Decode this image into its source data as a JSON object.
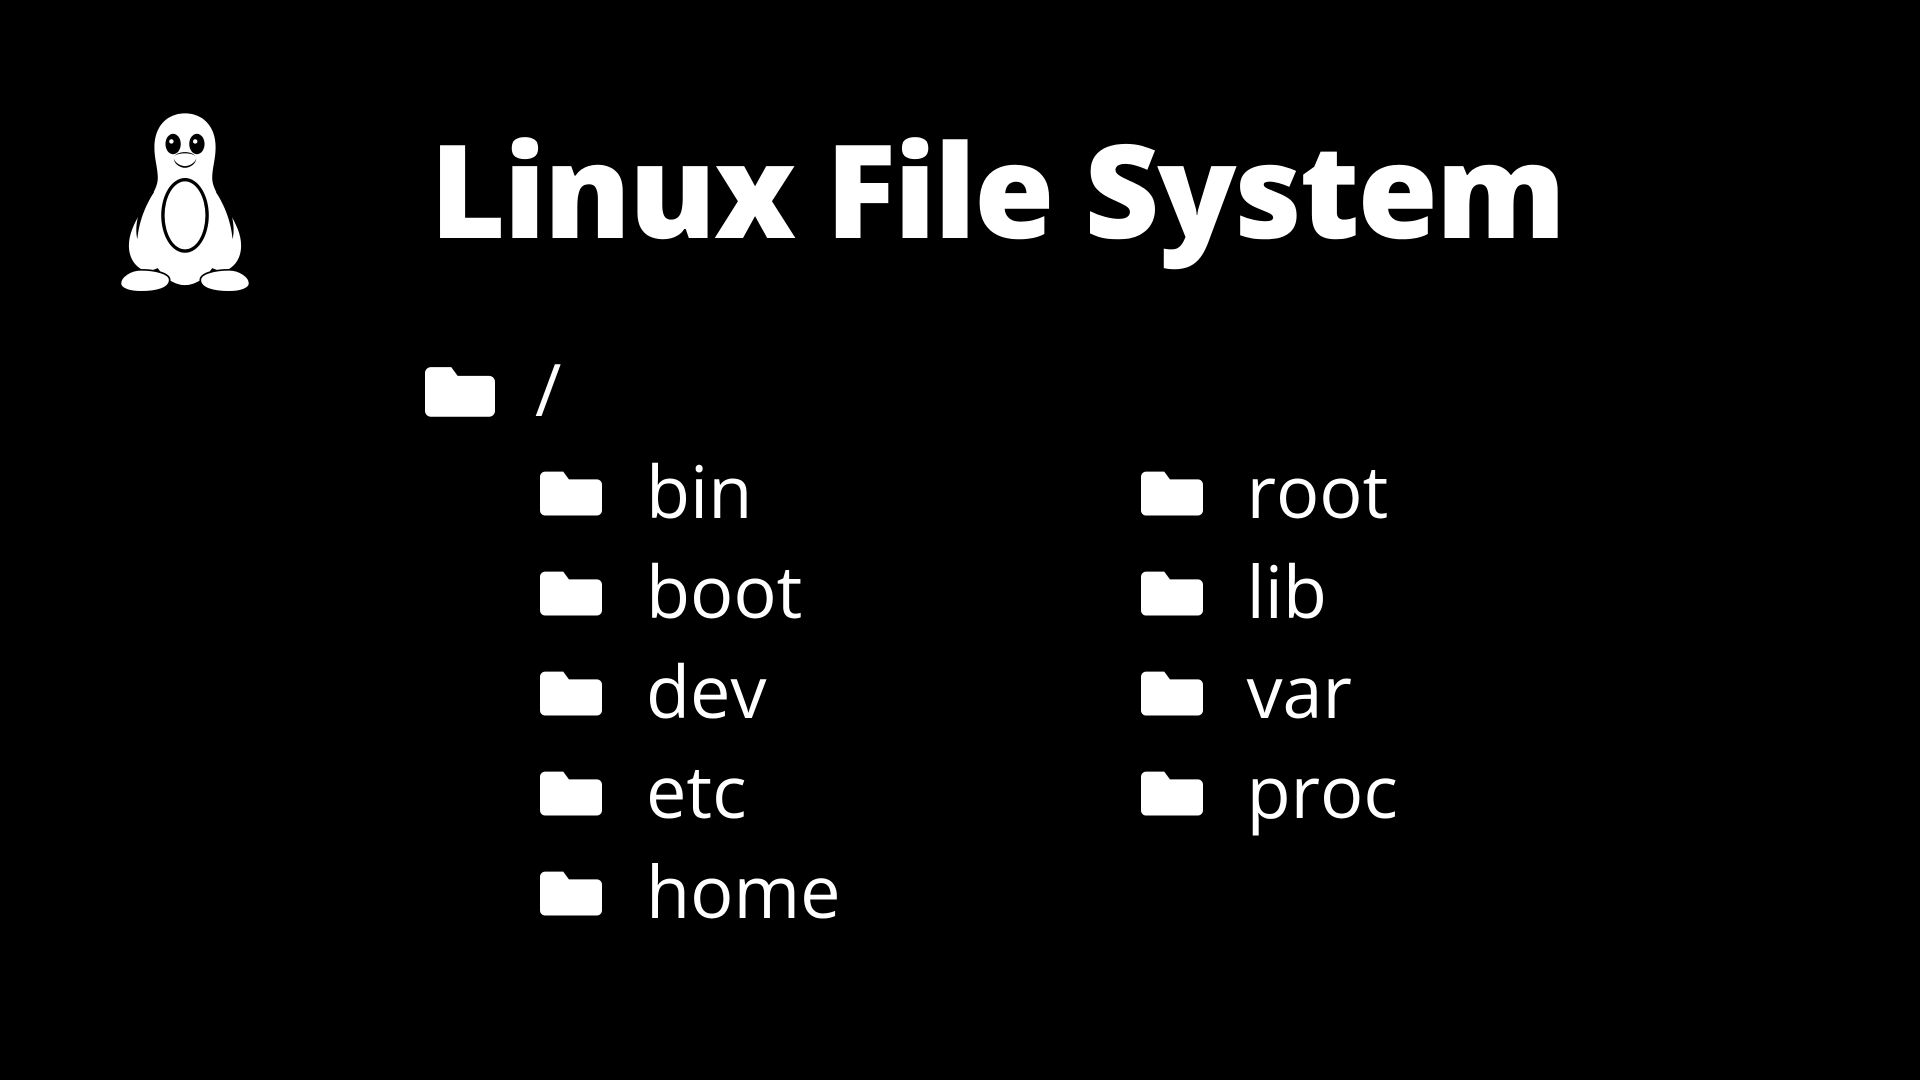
{
  "title": "Linux File System",
  "root": {
    "name": "/"
  },
  "columns": {
    "left": [
      "bin",
      "boot",
      "dev",
      "etc",
      "home"
    ],
    "right": [
      "root",
      "lib",
      "var",
      "proc"
    ]
  }
}
